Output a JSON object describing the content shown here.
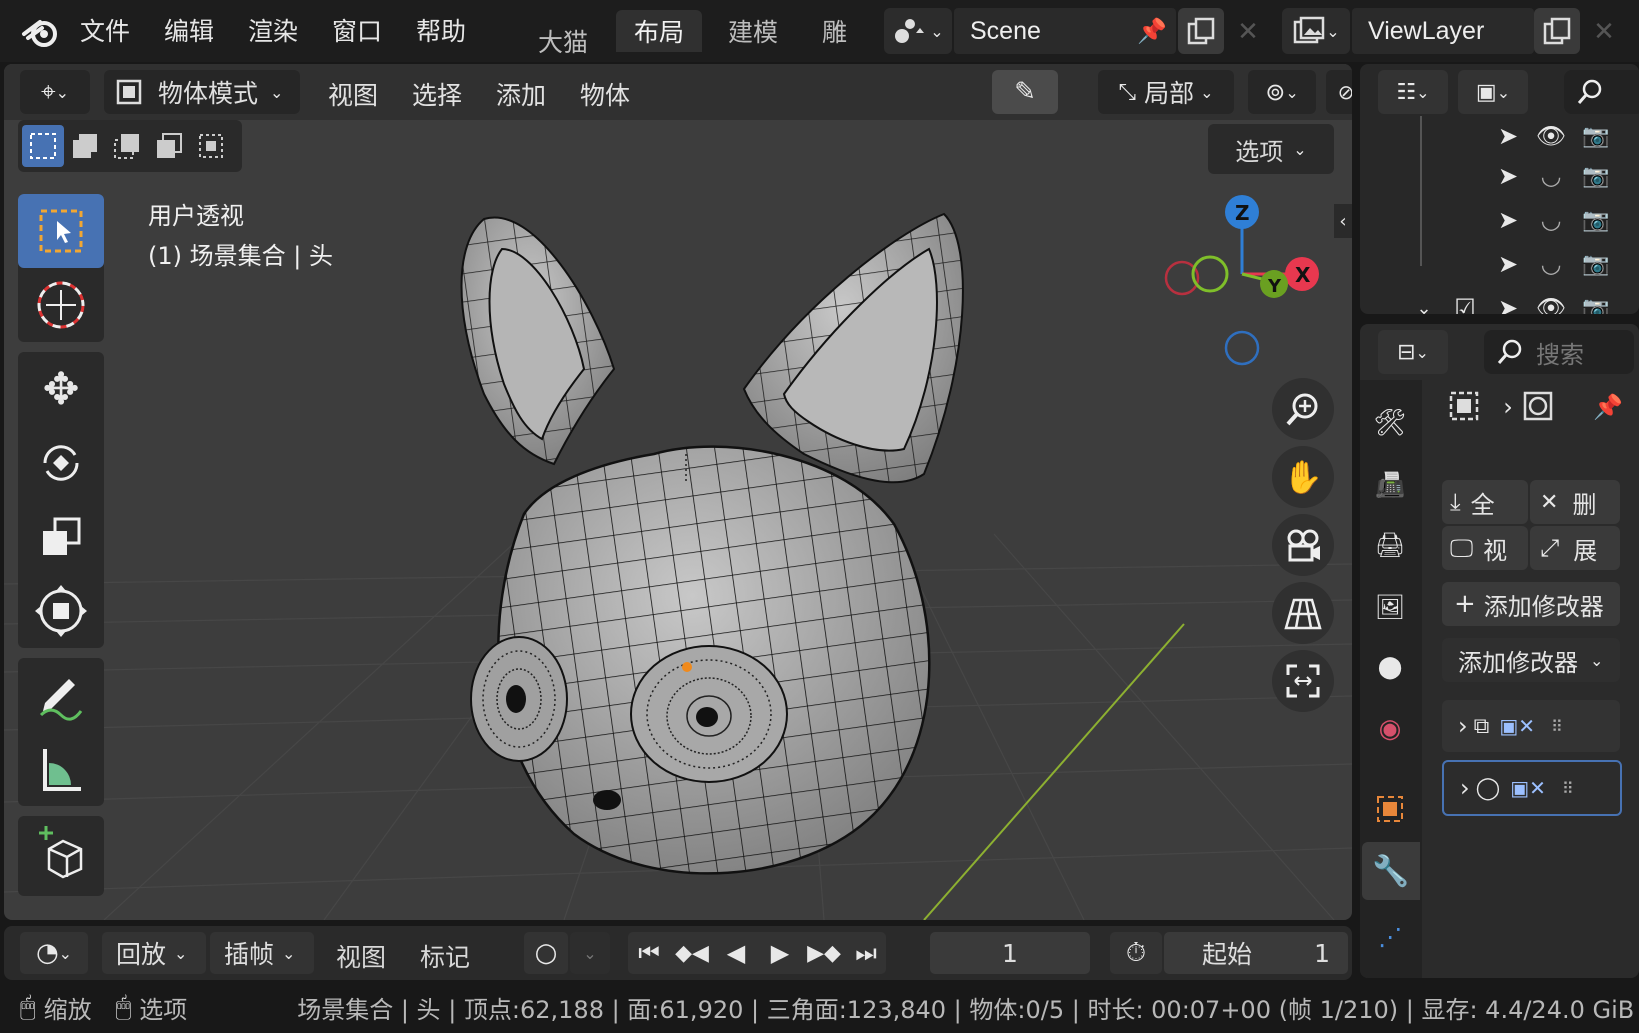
{
  "topbar": {
    "menu": [
      "文件",
      "编辑",
      "渲染",
      "窗口",
      "帮助"
    ],
    "workspaces": [
      "大猫",
      "布局",
      "建模",
      "雕刻"
    ],
    "active_workspace": "布局",
    "scene": "Scene",
    "view_layer": "ViewLayer"
  },
  "viewport": {
    "mode": "物体模式",
    "menus": [
      "视图",
      "选择",
      "添加",
      "物体"
    ],
    "transform_orientation": "局部",
    "options_label": "选项",
    "view_name": "用户透视",
    "context": "(1) 场景集合 | 头",
    "axes": {
      "x": "X",
      "y": "Y",
      "z": "Z"
    }
  },
  "properties": {
    "search_placeholder": "搜索",
    "ops": [
      "全",
      "删",
      "视",
      "展"
    ],
    "add_modifier": "添加修改器",
    "add_modifier_menu": "添加修改器"
  },
  "timeline": {
    "playback": "回放",
    "keying": "插帧",
    "view": "视图",
    "marker": "标记",
    "current_frame": "1",
    "start_label": "起始",
    "start_frame": "1"
  },
  "statusbar": {
    "zoom": "缩放",
    "options": "选项",
    "stats": "场景集合 | 头 | 顶点:62,188 | 面:61,920 | 三角面:123,840 | 物体:0/5 | 时长: 00:07+00 (帧 1/210) | 显存: 4.4/24.0 GiB"
  },
  "colors": {
    "accent": "#4772b3",
    "axis_x": "#e8384f",
    "axis_y": "#7fbf2a",
    "axis_z": "#2f7fd6",
    "mesh": "#a9a9a9"
  }
}
